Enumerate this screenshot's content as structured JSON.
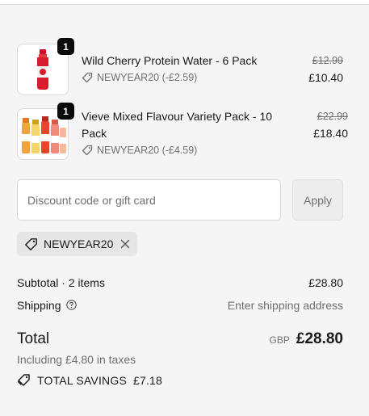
{
  "items": [
    {
      "quantity": "1",
      "title": "Wild Cherry Protein Water - 6 Pack",
      "discount": "NEWYEAR20 (-£2.59)",
      "original_price": "£12.99",
      "price": "£10.40",
      "image_icon": "red-bottle-icon"
    },
    {
      "quantity": "1",
      "title": "Vieve Mixed Flavour Variety Pack - 10 Pack",
      "discount": "NEWYEAR20 (-£4.59)",
      "original_price": "£22.99",
      "price": "£18.40",
      "image_icon": "multi-bottle-icon"
    }
  ],
  "discount": {
    "placeholder": "Discount code or gift card",
    "apply_label": "Apply",
    "applied_code": "NEWYEAR20"
  },
  "summary": {
    "subtotal_label": "Subtotal · 2 items",
    "subtotal_value": "£28.80",
    "shipping_label": "Shipping",
    "shipping_value": "Enter shipping address",
    "total_label": "Total",
    "currency": "GBP",
    "total_value": "£28.80",
    "taxes_note": "Including £4.80 in taxes",
    "savings_label": "TOTAL SAVINGS",
    "savings_value": "£7.18"
  },
  "colors": {
    "background": "#f5f5f5",
    "text": "#1a1a1a",
    "muted": "#707070",
    "badge": "#0b0b0b"
  }
}
